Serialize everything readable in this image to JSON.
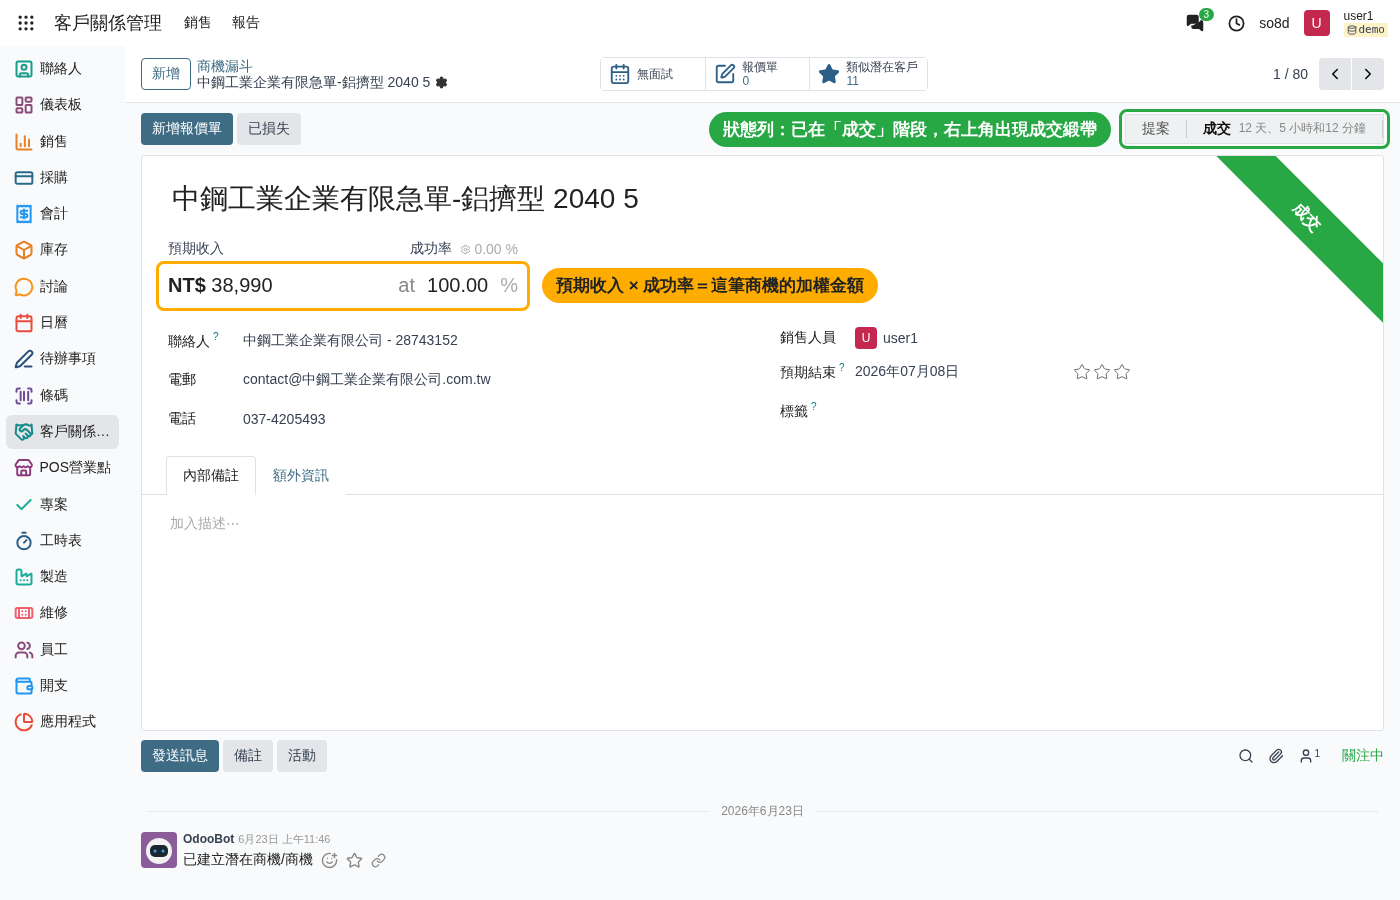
{
  "navbar": {
    "app_title": "客戶關係管理",
    "menus": [
      "銷售",
      "報告"
    ],
    "messages_count": "3",
    "database": "so8d",
    "avatar_letter": "U",
    "user": "user1",
    "db_badge": "demo"
  },
  "sidebar": {
    "items": [
      {
        "label": "聯絡人",
        "selected": false
      },
      {
        "label": "儀表板",
        "selected": false
      },
      {
        "label": "銷售",
        "selected": false
      },
      {
        "label": "採購",
        "selected": false
      },
      {
        "label": "會計",
        "selected": false
      },
      {
        "label": "庫存",
        "selected": false
      },
      {
        "label": "討論",
        "selected": false
      },
      {
        "label": "日曆",
        "selected": false
      },
      {
        "label": "待辦事項",
        "selected": false
      },
      {
        "label": "條碼",
        "selected": false
      },
      {
        "label": "客戶關係…",
        "selected": true
      },
      {
        "label": "POS營業點",
        "selected": false
      },
      {
        "label": "專案",
        "selected": false
      },
      {
        "label": "工時表",
        "selected": false
      },
      {
        "label": "製造",
        "selected": false
      },
      {
        "label": "維修",
        "selected": false
      },
      {
        "label": "員工",
        "selected": false
      },
      {
        "label": "開支",
        "selected": false
      },
      {
        "label": "應用程式",
        "selected": false
      }
    ]
  },
  "control_panel": {
    "new_button": "新增",
    "breadcrumb": "商機漏斗",
    "record_name": "中鋼工業企業有限急單-鋁擠型 2040 5",
    "smart_buttons": [
      {
        "kind": "calendar",
        "label": "無面試"
      },
      {
        "kind": "edit",
        "label": "報價單",
        "value": "0"
      },
      {
        "kind": "star",
        "label": "類似潛在客戶",
        "value": "11"
      }
    ],
    "pager": "1 / 80"
  },
  "actions": [
    {
      "label": "新增報價單",
      "kind": "primary"
    },
    {
      "label": "已損失",
      "kind": "secondary"
    }
  ],
  "statusbar": {
    "stages": [
      {
        "label": "提案",
        "selected": false
      },
      {
        "label": "成交",
        "selected": true,
        "duration": "12 天、5 小時和12 分鐘"
      }
    ]
  },
  "form": {
    "title": "中鋼工業企業有限急單-鋁擠型 2040 5",
    "ribbon": "成交",
    "revenue_label": "預期收入",
    "probability_label": "成功率",
    "auto_probability": "0.00 %",
    "revenue_currency": "NT$",
    "revenue_amount": "38,990",
    "at": "at",
    "probability": "100.00",
    "percent": "%",
    "left_fields": [
      {
        "label": "聯絡人",
        "help": "?",
        "value": "中鋼工業企業有限公司 - 28743152"
      },
      {
        "label": "電郵",
        "value": "contact@中鋼工業企業有限公司.com.tw"
      },
      {
        "label": "電話",
        "value": "037-4205493"
      }
    ],
    "salesperson": {
      "label": "銷售人員",
      "avatar_letter": "U",
      "value": "user1"
    },
    "deadline": {
      "label": "預期結束",
      "help": "?",
      "value": "2026年07月08日",
      "stars": 0
    },
    "tags": {
      "label": "標籤",
      "help": "?"
    },
    "tabs": [
      {
        "label": "內部備註",
        "selected": true
      },
      {
        "label": "額外資訊",
        "selected": false
      }
    ],
    "notes_placeholder": "加入描述⋯"
  },
  "chatter": {
    "buttons": [
      {
        "label": "發送訊息",
        "kind": "primary"
      },
      {
        "label": "備註",
        "kind": "secondary"
      },
      {
        "label": "活動",
        "kind": "secondary"
      }
    ],
    "followers_count": "1",
    "following": "關注中",
    "date_separator": "2026年6月23日",
    "messages": [
      {
        "author": "OdooBot",
        "time": "6月23日 上午11:46",
        "body": "已建立潛在商機/商機"
      }
    ]
  },
  "annotations": [
    {
      "kind": "statusbar",
      "text": "狀態列：已在「成交」階段，右上角出現成交緞帶",
      "color": "#28a745"
    },
    {
      "kind": "revenue",
      "text": "預期收入 × 成功率＝這筆商機的加權金額",
      "color": "#ffac00"
    }
  ]
}
